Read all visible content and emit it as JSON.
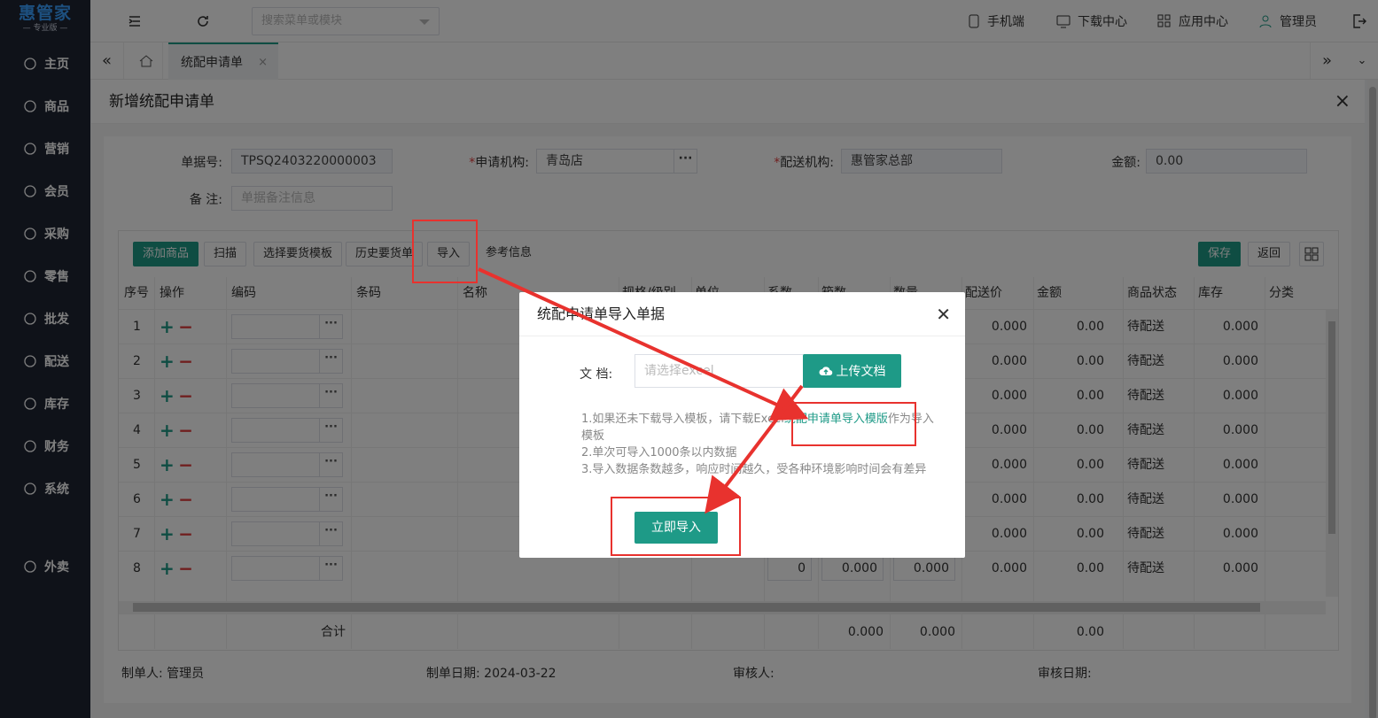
{
  "app": {
    "logo_title": "惠管家",
    "logo_sub": "— 专业版 —"
  },
  "sidebar": {
    "items": [
      {
        "label": "主页",
        "icon": "home-icon"
      },
      {
        "label": "商品",
        "icon": "cube-icon"
      },
      {
        "label": "营销",
        "icon": "chart-icon"
      },
      {
        "label": "会员",
        "icon": "diamond-icon"
      },
      {
        "label": "采购",
        "icon": "cart-icon"
      },
      {
        "label": "零售",
        "icon": "bag-icon"
      },
      {
        "label": "批发",
        "icon": "building-icon"
      },
      {
        "label": "配送",
        "icon": "truck-icon"
      },
      {
        "label": "库存",
        "icon": "box-icon"
      },
      {
        "label": "财务",
        "icon": "yen-icon"
      },
      {
        "label": "系统",
        "icon": "settings-icon"
      },
      {
        "label": "外卖",
        "icon": "bike-icon"
      }
    ]
  },
  "topbar": {
    "search_placeholder": "搜索菜单或模块",
    "mobile": "手机端",
    "download": "下载中心",
    "apps": "应用中心",
    "user": "管理员"
  },
  "tabs": {
    "active": "统配申请单"
  },
  "panel": {
    "title": "新增统配申请单",
    "form": {
      "doc_no_label": "单据号:",
      "doc_no": "TPSQ2403220000003",
      "apply_org_label": "申请机构:",
      "apply_org": "青岛店",
      "deliver_org_label": "配送机构:",
      "deliver_org": "惠管家总部",
      "amount_label": "金额:",
      "amount": "0.00",
      "remark_label": "备 注:",
      "remark_placeholder": "单据备注信息"
    },
    "toolbar": {
      "add": "添加商品",
      "scan": "扫描",
      "template": "选择要货模板",
      "history": "历史要货单",
      "import": "导入",
      "ref": "参考信息",
      "save": "保存",
      "back": "返回"
    },
    "columns": [
      "序号",
      "操作",
      "编码",
      "条码",
      "名称",
      "规格/级别",
      "单位",
      "系数",
      "箱数",
      "数量",
      "配送价",
      "金额",
      "商品状态",
      "库存",
      "分类"
    ],
    "rows": [
      {
        "no": "1",
        "price": "0.000",
        "amount": "0.00",
        "status": "待配送",
        "stock": "0.000"
      },
      {
        "no": "2",
        "price": "0.000",
        "amount": "0.00",
        "status": "待配送",
        "stock": "0.000"
      },
      {
        "no": "3",
        "price": "0.000",
        "amount": "0.00",
        "status": "待配送",
        "stock": "0.000"
      },
      {
        "no": "4",
        "price": "0.000",
        "amount": "0.00",
        "status": "待配送",
        "stock": "0.000"
      },
      {
        "no": "5",
        "price": "0.000",
        "amount": "0.00",
        "status": "待配送",
        "stock": "0.000"
      },
      {
        "no": "6",
        "price": "0.000",
        "amount": "0.00",
        "status": "待配送",
        "stock": "0.000"
      },
      {
        "no": "7",
        "price": "0.000",
        "amount": "0.00",
        "status": "待配送",
        "stock": "0.000"
      },
      {
        "no": "8",
        "factor": "0",
        "boxes": "0.000",
        "qty": "0.000",
        "price": "0.000",
        "amount": "0.00",
        "status": "待配送",
        "stock": "0.000"
      }
    ],
    "total": {
      "label": "合计",
      "boxes": "0.000",
      "qty": "0.000",
      "amount": "0.00"
    },
    "footer": {
      "maker_label": "制单人:",
      "maker": "管理员",
      "date_label": "制单日期:",
      "date": "2024-03-22",
      "auditor_label": "审核人:",
      "audit_date_label": "审核日期:"
    }
  },
  "dialog": {
    "title": "统配申请单导入单据",
    "doc_label": "文 档:",
    "doc_placeholder": "请选择excel",
    "upload": "上传文档",
    "note1_pre": "1.如果还未下载导入模板，请下载Excel",
    "note1_link": "统配申请单导入模版",
    "note1_post": "作为导入模板",
    "note2": "2.单次可导入1000条以内数据",
    "note3": "3.导入数据条数越多，响应时间越久，受各种环境影响时间会有差异",
    "import": "立即导入"
  },
  "colors": {
    "accent": "#1e9a87",
    "sidebar": "#1f2433",
    "annotation": "#e8322e"
  }
}
